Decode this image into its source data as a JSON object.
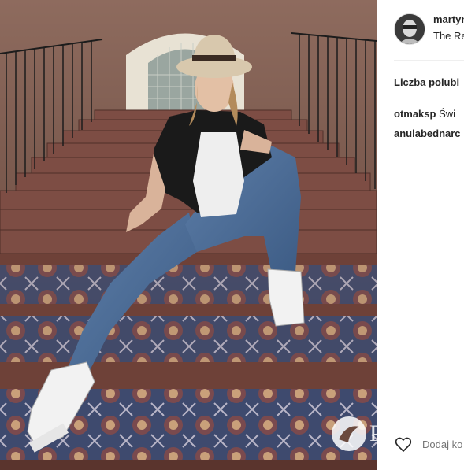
{
  "post": {
    "username": "martyn",
    "location": "The Re",
    "likes_label": "Liczba polubi",
    "comments": [
      {
        "user": "otmaksp",
        "text": "Świ"
      },
      {
        "user": "anulabednarc",
        "text": ""
      }
    ],
    "add_comment_placeholder": "Dodaj ko",
    "watermark_text": "P"
  },
  "icons": {
    "like": "heart-outline-icon",
    "watermark": "brand-logo-icon"
  },
  "colors": {
    "text": "#262626",
    "muted": "#999999",
    "divider": "#efefef"
  }
}
